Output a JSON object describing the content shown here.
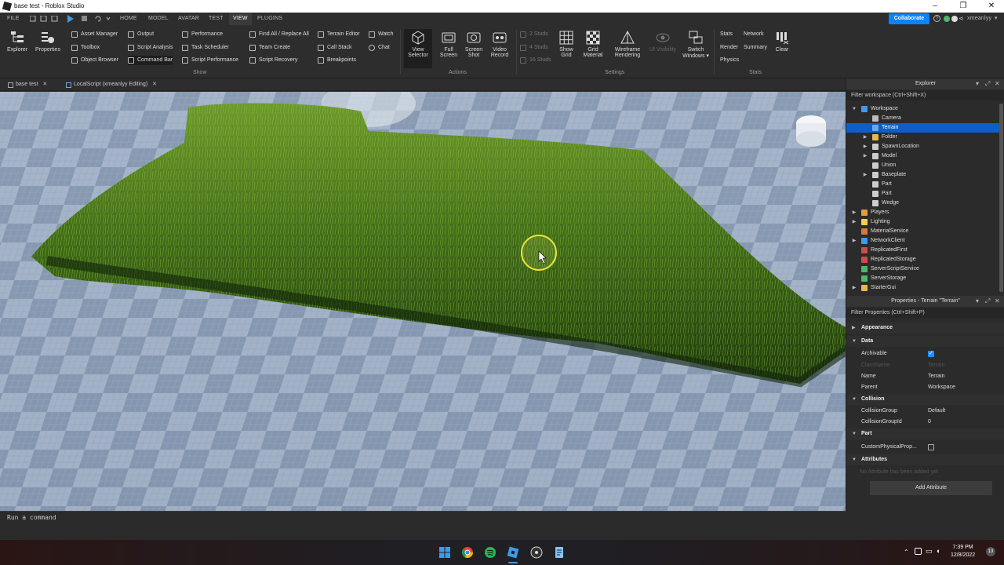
{
  "window": {
    "title": "base test - Roblox Studio",
    "minimize": "–",
    "maximize": "❐",
    "close": "✕"
  },
  "menu": {
    "file": "FILE",
    "tabs": [
      "HOME",
      "MODEL",
      "AVATAR",
      "TEST",
      "VIEW",
      "PLUGINS"
    ],
    "active_tab": "VIEW",
    "collaborate": "Collaborate",
    "user": "xmeanlyy"
  },
  "ribbon": {
    "explorer": "Explorer",
    "properties": "Properties",
    "show_items": [
      "Asset Manager",
      "Toolbox",
      "Object Browser",
      "Output",
      "Script Analysis",
      "Command Bar",
      "Performance",
      "Task Scheduler",
      "Script Performance",
      "Find All / Replace All",
      "Team Create",
      "Script Recovery",
      "Terrain Editor",
      "Call Stack",
      "Breakpoints",
      "Watch",
      "Chat"
    ],
    "show_label": "Show",
    "view_selector": [
      "View",
      "Selector"
    ],
    "full_screen": [
      "Full",
      "Screen"
    ],
    "screen_shot": [
      "Screen",
      "Shot"
    ],
    "video_record": [
      "Video",
      "Record"
    ],
    "actions_label": "Actions",
    "studs": [
      "2 Studs",
      "4 Studs",
      "16 Studs"
    ],
    "show_grid": [
      "Show",
      "Grid"
    ],
    "grid_material": [
      "Grid",
      "Material"
    ],
    "wireframe": [
      "Wireframe",
      "Rendering"
    ],
    "ui_visibility": "UI Visibility",
    "switch_windows": [
      "Switch",
      "Windows ▾"
    ],
    "settings_label": "Settings",
    "stats_items": [
      "Stats",
      "Network",
      "Render",
      "Summary",
      "Physics"
    ],
    "clear": "Clear",
    "stats_label": "Stats"
  },
  "doc_tabs": [
    {
      "label": "base test",
      "close": "✕"
    },
    {
      "label": "LocalScript (xmeanlyy Editing)",
      "close": "✕"
    }
  ],
  "command_bar": {
    "placeholder": "Run a command"
  },
  "explorer": {
    "title": "Explorer",
    "filter": "Filter workspace (Ctrl+Shift+X)",
    "items": [
      {
        "label": "Workspace",
        "depth": 0,
        "expanded": true,
        "icon": "workspace",
        "color": "#3d9be9"
      },
      {
        "label": "Camera",
        "depth": 1,
        "icon": "camera",
        "color": "#bbbbbb"
      },
      {
        "label": "Terrain",
        "depth": 1,
        "icon": "terrain",
        "color": "#6ba8e8",
        "selected": true
      },
      {
        "label": "Folder",
        "depth": 1,
        "collapsed": true,
        "icon": "folder",
        "color": "#e8b84a"
      },
      {
        "label": "SpawnLocation",
        "depth": 1,
        "collapsed": true,
        "icon": "spawn",
        "color": "#cccccc"
      },
      {
        "label": "Model",
        "depth": 1,
        "collapsed": true,
        "icon": "model",
        "color": "#cccccc"
      },
      {
        "label": "Union",
        "depth": 1,
        "icon": "union",
        "color": "#cccccc"
      },
      {
        "label": "Baseplate",
        "depth": 1,
        "collapsed": true,
        "icon": "part",
        "color": "#cccccc"
      },
      {
        "label": "Part",
        "depth": 1,
        "icon": "part",
        "color": "#cccccc"
      },
      {
        "label": "Part",
        "depth": 1,
        "icon": "part",
        "color": "#cccccc"
      },
      {
        "label": "Wedge",
        "depth": 1,
        "icon": "wedge",
        "color": "#cccccc"
      },
      {
        "label": "Players",
        "depth": 0,
        "collapsed": true,
        "icon": "players",
        "color": "#e89a3a"
      },
      {
        "label": "Lighting",
        "depth": 0,
        "collapsed": true,
        "icon": "lighting",
        "color": "#f3d13d"
      },
      {
        "label": "MaterialService",
        "depth": 0,
        "icon": "material",
        "color": "#d67a3a"
      },
      {
        "label": "NetworkClient",
        "depth": 0,
        "collapsed": true,
        "icon": "network",
        "color": "#3d9be9"
      },
      {
        "label": "ReplicatedFirst",
        "depth": 0,
        "icon": "replicated",
        "color": "#d14a4a"
      },
      {
        "label": "ReplicatedStorage",
        "depth": 0,
        "icon": "replicated",
        "color": "#d14a4a"
      },
      {
        "label": "ServerScriptService",
        "depth": 0,
        "icon": "server-script",
        "color": "#4ab86a"
      },
      {
        "label": "ServerStorage",
        "depth": 0,
        "icon": "server-storage",
        "color": "#4ab86a"
      },
      {
        "label": "StarterGui",
        "depth": 0,
        "collapsed": true,
        "icon": "gui",
        "color": "#e8b84a"
      }
    ]
  },
  "properties": {
    "title": "Properties - Terrain \"Terrain\"",
    "filter": "Filter Properties (Ctrl+Shift+P)",
    "categories": {
      "appearance": "Appearance",
      "data": "Data",
      "collision": "Collision",
      "part": "Part",
      "attributes": "Attributes"
    },
    "rows": {
      "archivable": {
        "name": "Archivable",
        "checked": true
      },
      "classname": {
        "name": "ClassName",
        "value": "Terrain"
      },
      "name": {
        "name": "Name",
        "value": "Terrain"
      },
      "parent": {
        "name": "Parent",
        "value": "Workspace"
      },
      "collisiongroup": {
        "name": "CollisionGroup",
        "value": "Default"
      },
      "collisiongroupid": {
        "name": "CollisionGroupId",
        "value": "0"
      },
      "customphysical": {
        "name": "CustomPhysicalProp...",
        "checked": false
      }
    },
    "no_attributes": "No Attribute has been added yet",
    "add_attribute": "Add Attribute"
  },
  "taskbar": {
    "time": "7:39 PM",
    "date": "12/8/2022",
    "notifications": "13"
  }
}
